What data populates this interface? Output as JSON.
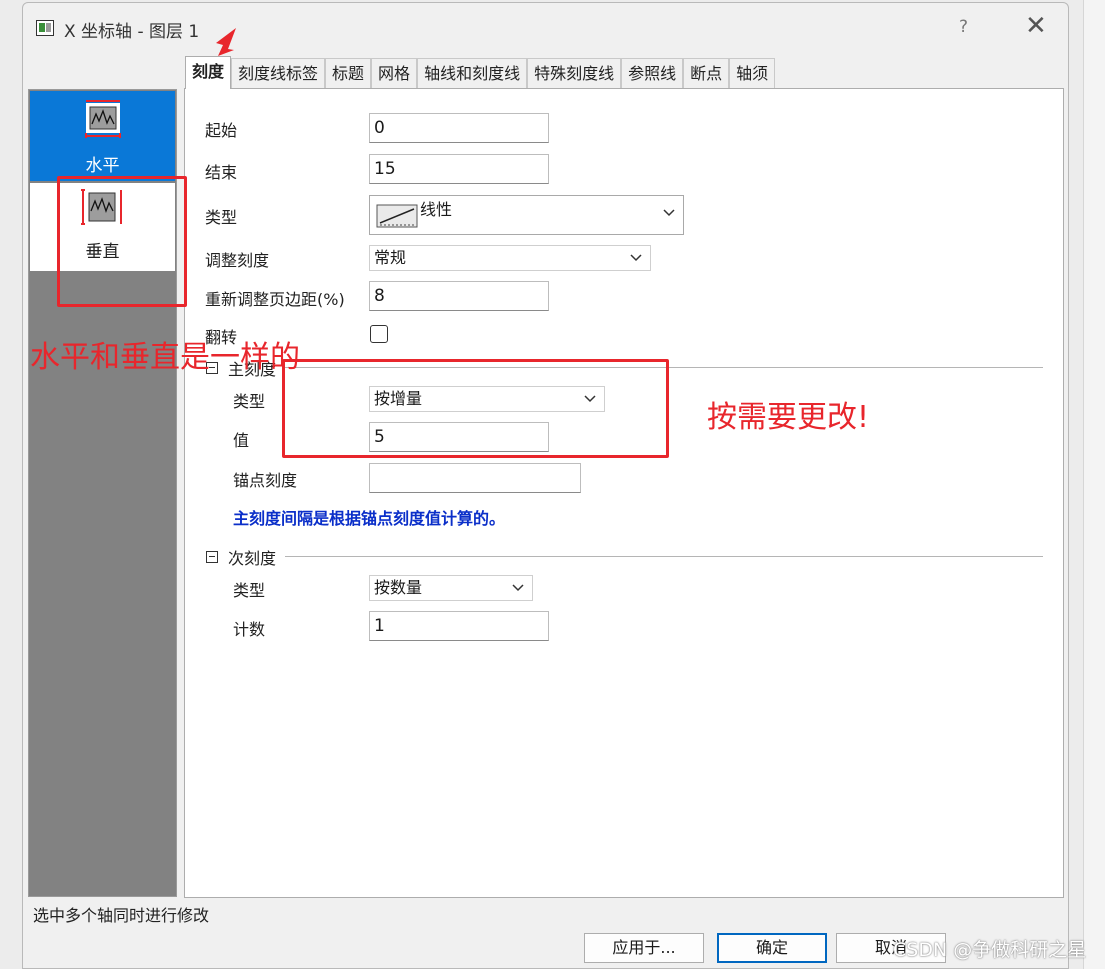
{
  "window": {
    "title": "X 坐标轴 - 图层 1",
    "help_label": "?",
    "close_label": "✕"
  },
  "tabs": [
    {
      "label": "刻度",
      "active": true
    },
    {
      "label": "刻度线标签"
    },
    {
      "label": "标题"
    },
    {
      "label": "网格"
    },
    {
      "label": "轴线和刻度线"
    },
    {
      "label": "特殊刻度线"
    },
    {
      "label": "参照线"
    },
    {
      "label": "断点"
    },
    {
      "label": "轴须"
    }
  ],
  "axes_list": [
    {
      "label": "水平",
      "selected": true
    },
    {
      "label": "垂直",
      "selected": false
    }
  ],
  "scale": {
    "start_label": "起始",
    "start_value": "0",
    "end_label": "结束",
    "end_value": "15",
    "type_label": "类型",
    "type_value": "线性",
    "rescale_label": "调整刻度",
    "rescale_value": "常规",
    "margin_label": "重新调整页边距(%)",
    "margin_value": "8",
    "reverse_label": "翻转",
    "reverse_checked": false
  },
  "major_ticks": {
    "section_label": "主刻度",
    "type_label": "类型",
    "type_value": "按增量",
    "value_label": "值",
    "value_value": "5",
    "anchor_label": "锚点刻度",
    "anchor_value": "",
    "note": "主刻度间隔是根据锚点刻度值计算的。"
  },
  "minor_ticks": {
    "section_label": "次刻度",
    "type_label": "类型",
    "type_value": "按数量",
    "count_label": "计数",
    "count_value": "1"
  },
  "footer": {
    "status_text": "选中多个轴同时进行修改",
    "apply_label": "应用于...",
    "ok_label": "确定",
    "cancel_label": "取消"
  },
  "annotations": {
    "left_note": "水平和垂直是一样的",
    "right_note": "按需要更改!",
    "color": "#e8262c"
  },
  "watermark": "CSDN @争做科研之星",
  "colors": {
    "selection": "#0a78d7",
    "note_text": "#0b2fc9",
    "panel_gray": "#828282"
  }
}
